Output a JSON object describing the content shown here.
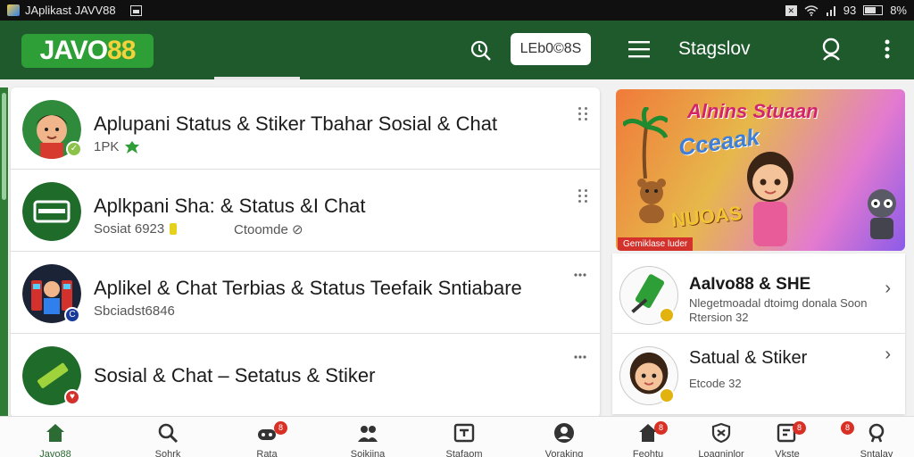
{
  "status_bar": {
    "app_title": "JAplikast JAVV88",
    "signal_text": "93",
    "battery_text": "8%",
    "close_glyph": "✕"
  },
  "app_bar": {
    "logo_main": "JAVO",
    "logo_accent": "88",
    "search_chip": "LEb0©8S",
    "title": "Stagslov",
    "brand_color": "#1f5a2d",
    "accent_color": "#2e9e36"
  },
  "list": {
    "items": [
      {
        "title": "Aplupani Status & Stiker Tbahar Sosial & Chat",
        "subtitle": "1PK",
        "avatar_icon": "cartoon-boy-avatar-icon",
        "badge_icon": "green-check-badge-icon"
      },
      {
        "title": "Aplkpani Sha: & Status &I Chat",
        "subtitle": "Sosiat 6923",
        "subtitle2": "Ctoomde ⊘",
        "avatar_icon": "chat-card-avatar-icon"
      },
      {
        "title": "Aplikel & Chat Terbias & Status Teefaik Sntiabare",
        "subtitle": "Sbciadst6846",
        "avatar_icon": "arcade-avatar-icon",
        "badge_icon": "blue-c-badge-icon"
      },
      {
        "title": "Sosial & Chat – Setatus & Stiker",
        "subtitle": "",
        "avatar_icon": "sticker-avatar-icon",
        "badge_icon": "heart-badge-icon"
      }
    ]
  },
  "promo": {
    "title": "Alnins Stuaan",
    "subtitle": "Cceaak",
    "word": "NUOAS",
    "tag": "Gemiklase luder"
  },
  "side_list": {
    "items": [
      {
        "title": "AaIvo88 & SHE",
        "line1": "Nlegetmoadal dtoimg donala Soon",
        "line2": "Rtersion 32",
        "avatar_icon": "phone-sticker-avatar-icon"
      },
      {
        "title": "Satual & Stiker",
        "line1": "",
        "line2": "Etcode 32",
        "avatar_icon": "girl-avatar-icon"
      }
    ]
  },
  "bottom_nav": {
    "items": [
      {
        "label": "Javo88",
        "icon": "home-icon",
        "active": true
      },
      {
        "label": "Sohrk",
        "icon": "search-icon"
      },
      {
        "label": "Rata",
        "icon": "gamepad-icon",
        "badge": "8"
      },
      {
        "label": "Sojkiina",
        "icon": "people-icon"
      },
      {
        "label": "Stafaom",
        "icon": "inbox-icon"
      },
      {
        "label": "Voraking",
        "icon": "profile-icon"
      },
      {
        "label": "Feohtu",
        "icon": "home-icon-2",
        "badge": "8"
      },
      {
        "label": "Loagninlor",
        "icon": "shield-x-icon"
      },
      {
        "label": "Vkste",
        "icon": "edit-icon",
        "badge": "8"
      },
      {
        "label": "Sntalay",
        "icon": "search-icon-2",
        "badge": "8"
      }
    ]
  }
}
